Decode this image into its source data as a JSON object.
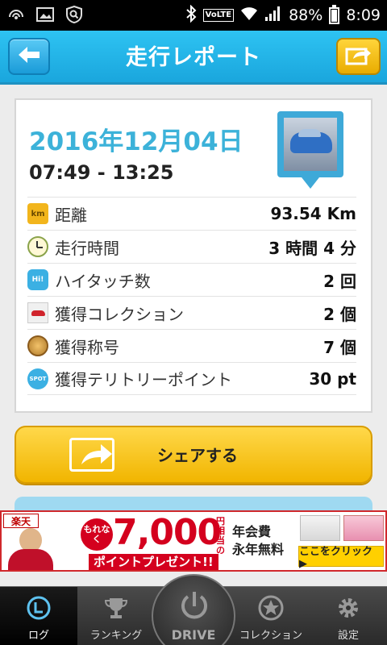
{
  "status_bar": {
    "battery": "88%",
    "time": "8:09",
    "network_label": "VoLTE",
    "battery_level": 0.88
  },
  "header": {
    "title": "走行レポート",
    "back_icon": "back-arrow-icon",
    "share_icon": "share-arrow-icon"
  },
  "report": {
    "date": "2016年12月04日",
    "time_range": "07:49 - 13:25",
    "rows": [
      {
        "icon": "km-icon",
        "icon_text": "km",
        "label": "距離",
        "value": "93.54 Km"
      },
      {
        "icon": "clock-icon",
        "label": "走行時間",
        "value": "3 時間 4 分"
      },
      {
        "icon": "hi-touch-icon",
        "icon_text": "Hi!",
        "label": "ハイタッチ数",
        "value": "2 回"
      },
      {
        "icon": "car-collection-icon",
        "label": "獲得コレクション",
        "value": "2 個"
      },
      {
        "icon": "medal-icon",
        "label": "獲得称号",
        "value": "7 個"
      },
      {
        "icon": "spot-icon",
        "icon_text": "SPOT",
        "label": "獲得テリトリーポイント",
        "value": "30 pt"
      }
    ]
  },
  "share": {
    "label": "シェアする"
  },
  "ad": {
    "brand": "楽天",
    "motto": "もれなく",
    "amount": "7,000",
    "amount_suffix": "円相当の",
    "present": "ポイントプレゼント!!",
    "fee_line1": "年会費",
    "fee_line2": "永年無料",
    "cta": "ここをクリック ▶"
  },
  "tabs": [
    {
      "label": "ログ",
      "icon": "log-icon",
      "active": true
    },
    {
      "label": "ランキング",
      "icon": "trophy-icon",
      "active": false
    },
    {
      "label": "DRIVE",
      "icon": "power-icon",
      "active": false
    },
    {
      "label": "コレクション",
      "icon": "star-icon",
      "active": false
    },
    {
      "label": "設定",
      "icon": "gear-icon",
      "active": false
    }
  ],
  "colors": {
    "header": "#1aa6dd",
    "date": "#3cb2d9",
    "share_button": "#f1b500",
    "ad_red": "#d4001e"
  }
}
